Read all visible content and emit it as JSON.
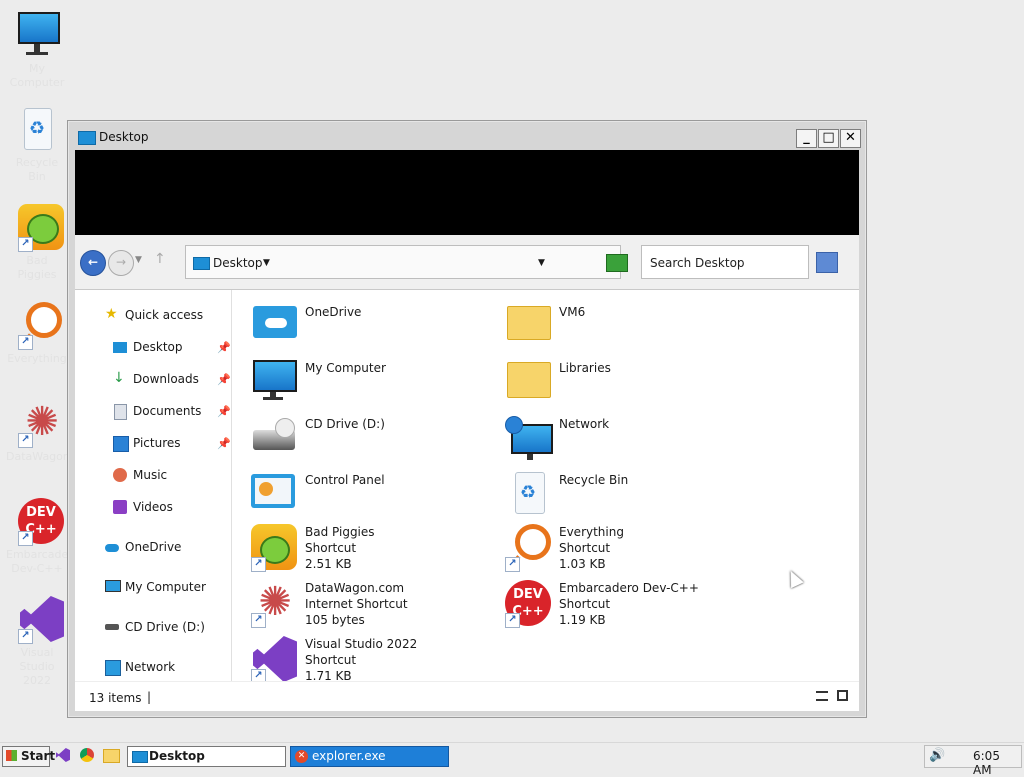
{
  "desktop": {
    "icons": [
      {
        "label": "My\nComputer"
      },
      {
        "label": "Recycle Bin"
      },
      {
        "label": "Bad Piggies"
      },
      {
        "label": "Everything"
      },
      {
        "label": "DataWagon"
      },
      {
        "label": "Embarcadero\nDev-C++"
      },
      {
        "label": "Visual Studio\n2022"
      }
    ]
  },
  "window": {
    "title": "Desktop",
    "controls": {
      "minimize": "_",
      "maximize": "□",
      "close": "✕"
    },
    "address": "Desktop",
    "search_placeholder": "Search Desktop",
    "nav_pane": {
      "quick_access": "Quick access",
      "pinned": [
        "Desktop",
        "Downloads",
        "Documents",
        "Pictures"
      ],
      "unpinned": [
        "Music",
        "Videos"
      ],
      "roots": [
        "OneDrive",
        "My Computer",
        "CD Drive (D:)",
        "Network"
      ]
    },
    "items": [
      {
        "name": "OneDrive",
        "line2": "",
        "line3": ""
      },
      {
        "name": "VM6",
        "line2": "",
        "line3": ""
      },
      {
        "name": "My Computer",
        "line2": "",
        "line3": ""
      },
      {
        "name": "Libraries",
        "line2": "",
        "line3": ""
      },
      {
        "name": "CD Drive (D:)",
        "line2": "",
        "line3": ""
      },
      {
        "name": "Network",
        "line2": "",
        "line3": ""
      },
      {
        "name": "Control Panel",
        "line2": "",
        "line3": ""
      },
      {
        "name": "Recycle Bin",
        "line2": "",
        "line3": ""
      },
      {
        "name": "Bad Piggies",
        "line2": "Shortcut",
        "line3": "2.51 KB"
      },
      {
        "name": "Everything",
        "line2": "Shortcut",
        "line3": "1.03 KB"
      },
      {
        "name": "DataWagon.com",
        "line2": "Internet Shortcut",
        "line3": "105 bytes"
      },
      {
        "name": "Embarcadero Dev-C++",
        "line2": "Shortcut",
        "line3": "1.19 KB"
      },
      {
        "name": "Visual Studio 2022",
        "line2": "Shortcut",
        "line3": "1.71 KB"
      }
    ],
    "status": {
      "count": "13 items",
      "separator": "|"
    }
  },
  "taskbar": {
    "start": "Start",
    "tasks": [
      {
        "label": "Desktop"
      },
      {
        "label": "explorer.exe"
      }
    ],
    "clock": "6:05 AM"
  }
}
